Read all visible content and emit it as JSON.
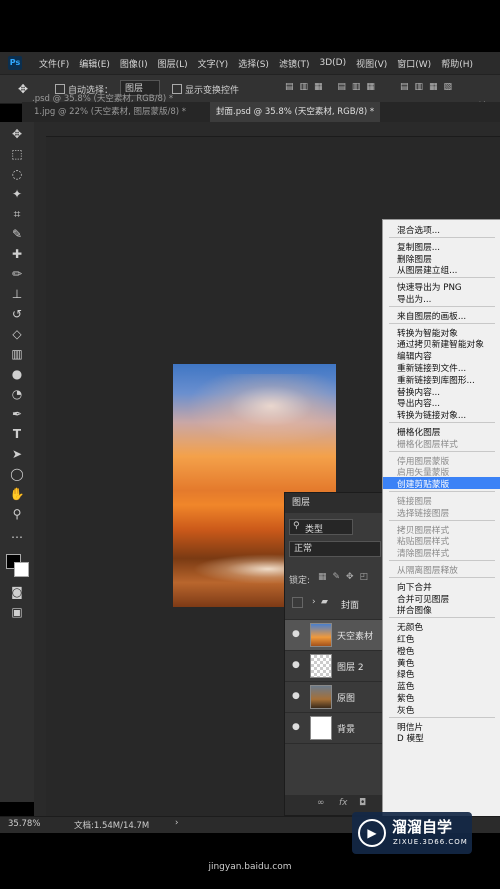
{
  "app": {
    "logo": "Ps"
  },
  "menu": [
    "文件(F)",
    "编辑(E)",
    "图像(I)",
    "图层(L)",
    "文字(Y)",
    "选择(S)",
    "滤镜(T)",
    "3D(D)",
    "视图(V)",
    "窗口(W)",
    "帮助(H)"
  ],
  "options": {
    "auto_select_label": "自动选择：",
    "auto_select_value": "图层",
    "show_transform_label": "显示变换控件"
  },
  "tabs": [
    {
      "label": ".psd @ 35.8% (天空素材, RGB/8) *"
    },
    {
      "label": "1.jpg @ 22% (天空素材, 图层蒙版/8) *"
    },
    {
      "label": "封面.psd @ 35.8% (天空素材, RGB/8) *"
    }
  ],
  "layers_panel": {
    "title": "图层",
    "filter": "类型",
    "blend_mode": "正常",
    "lock_label": "锁定:",
    "layers": [
      {
        "name": "封面",
        "type": "group"
      },
      {
        "name": "天空素材",
        "type": "layer",
        "selected": true
      },
      {
        "name": "图层 2",
        "type": "layer"
      },
      {
        "name": "原图",
        "type": "layer"
      },
      {
        "name": "背景",
        "type": "layer"
      }
    ],
    "footer_icons": [
      "link-icon",
      "fx-icon",
      "mask-icon"
    ]
  },
  "context_menu": {
    "items": [
      {
        "label": "混合选项...",
        "state": "normal"
      },
      {
        "sep": true
      },
      {
        "label": "复制图层...",
        "state": "normal"
      },
      {
        "label": "删除图层",
        "state": "normal"
      },
      {
        "label": "从图层建立组...",
        "state": "normal"
      },
      {
        "sep": true
      },
      {
        "label": "快速导出为 PNG",
        "state": "normal"
      },
      {
        "label": "导出为...",
        "state": "normal"
      },
      {
        "sep": true
      },
      {
        "label": "来自图层的画板...",
        "state": "normal"
      },
      {
        "sep": true
      },
      {
        "label": "转换为智能对象",
        "state": "normal"
      },
      {
        "label": "通过拷贝新建智能对象",
        "state": "normal"
      },
      {
        "label": "编辑内容",
        "state": "normal"
      },
      {
        "label": "重新链接到文件...",
        "state": "normal"
      },
      {
        "label": "重新链接到库图形...",
        "state": "normal"
      },
      {
        "label": "替换内容...",
        "state": "normal"
      },
      {
        "label": "导出内容...",
        "state": "normal"
      },
      {
        "label": "转换为链接对象...",
        "state": "normal"
      },
      {
        "sep": true
      },
      {
        "label": "栅格化图层",
        "state": "normal"
      },
      {
        "label": "栅格化图层样式",
        "state": "disabled"
      },
      {
        "sep": true
      },
      {
        "label": "停用图层蒙版",
        "state": "disabled"
      },
      {
        "label": "启用矢量蒙版",
        "state": "disabled"
      },
      {
        "label": "创建剪贴蒙版",
        "state": "highlighted"
      },
      {
        "sep": true
      },
      {
        "label": "链接图层",
        "state": "disabled"
      },
      {
        "label": "选择链接图层",
        "state": "disabled"
      },
      {
        "sep": true
      },
      {
        "label": "拷贝图层样式",
        "state": "disabled"
      },
      {
        "label": "粘贴图层样式",
        "state": "disabled"
      },
      {
        "label": "清除图层样式",
        "state": "disabled"
      },
      {
        "sep": true
      },
      {
        "label": "从隔离图层释放",
        "state": "disabled"
      },
      {
        "sep": true
      },
      {
        "label": "向下合并",
        "state": "normal"
      },
      {
        "label": "合并可见图层",
        "state": "normal"
      },
      {
        "label": "拼合图像",
        "state": "normal"
      },
      {
        "sep": true
      },
      {
        "label": "无颜色",
        "state": "normal"
      },
      {
        "label": "红色",
        "state": "normal"
      },
      {
        "label": "橙色",
        "state": "normal"
      },
      {
        "label": "黄色",
        "state": "normal"
      },
      {
        "label": "绿色",
        "state": "normal"
      },
      {
        "label": "蓝色",
        "state": "normal"
      },
      {
        "label": "紫色",
        "state": "normal"
      },
      {
        "label": "灰色",
        "state": "normal"
      },
      {
        "sep": true
      },
      {
        "label": "明信片",
        "state": "normal"
      },
      {
        "label": "D 模型",
        "state": "normal"
      }
    ]
  },
  "status": {
    "zoom": "35.78%",
    "doc": "文档:1.54M/14.7M"
  },
  "watermark": {
    "title": "溜溜自学",
    "sub": "ZIXUE.3D66.COM"
  },
  "footer_url": "jingyan.baidu.com",
  "colors": {
    "highlight": "#3b82f6",
    "panel": "#3a3a3a",
    "canvas": "#282828"
  }
}
